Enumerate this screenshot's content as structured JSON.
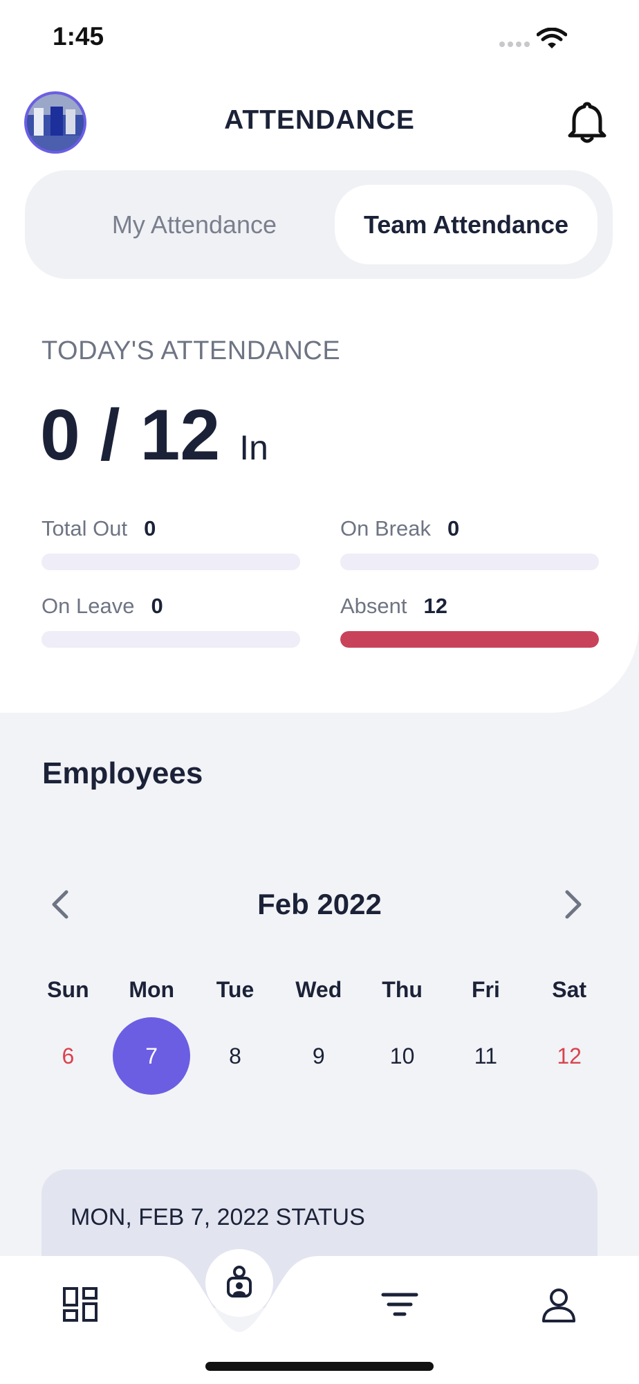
{
  "status_bar": {
    "time": "1:45"
  },
  "header": {
    "title": "ATTENDANCE"
  },
  "tabs": {
    "my": "My Attendance",
    "team": "Team Attendance",
    "active": "team"
  },
  "today": {
    "label": "TODAY'S ATTENDANCE",
    "count_text": "0 / 12",
    "in_label": "In",
    "metrics": [
      {
        "label": "Total Out",
        "value": "0",
        "fraction": 0,
        "color": "#c8435a"
      },
      {
        "label": "On Break",
        "value": "0",
        "fraction": 0,
        "color": "#c8435a"
      },
      {
        "label": "On Leave",
        "value": "0",
        "fraction": 0,
        "color": "#c8435a"
      },
      {
        "label": "Absent",
        "value": "12",
        "fraction": 1,
        "color": "#c8435a"
      }
    ]
  },
  "employees": {
    "title": "Employees",
    "calendar": {
      "month": "Feb 2022",
      "weekdays": [
        "Sun",
        "Mon",
        "Tue",
        "Wed",
        "Thu",
        "Fri",
        "Sat"
      ],
      "days": [
        {
          "num": "6",
          "weekend": true,
          "selected": false
        },
        {
          "num": "7",
          "weekend": false,
          "selected": true
        },
        {
          "num": "8",
          "weekend": false,
          "selected": false
        },
        {
          "num": "9",
          "weekend": false,
          "selected": false
        },
        {
          "num": "10",
          "weekend": false,
          "selected": false
        },
        {
          "num": "11",
          "weekend": false,
          "selected": false
        },
        {
          "num": "12",
          "weekend": true,
          "selected": false
        }
      ],
      "selected_color": "#6b5ee3",
      "weekend_color": "#d9434e"
    },
    "status_card_title": "MON, FEB 7, 2022 STATUS"
  },
  "nav": {
    "items": [
      "dashboard-icon",
      "attendance-icon",
      "filter-icon",
      "profile-icon"
    ]
  },
  "colors": {
    "accent": "#6b5ee3",
    "absent": "#c8435a",
    "text": "#1b2238"
  }
}
